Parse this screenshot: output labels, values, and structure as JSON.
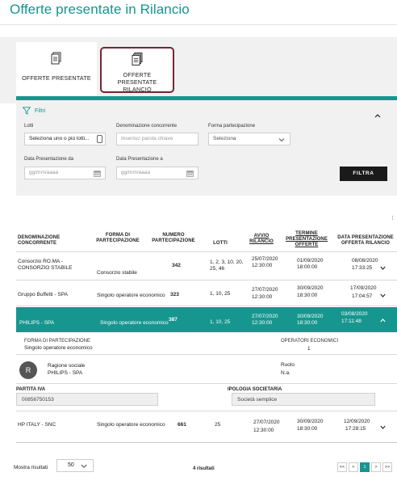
{
  "page": {
    "title": "Offerte presentate in Rilancio"
  },
  "tabs": [
    {
      "label": "OFFERTE PRESENTATE",
      "icon": "document-icon"
    },
    {
      "label": "OFFERTE PRESENTATE RILANCIO",
      "icon": "document-stack-icon",
      "selected": true
    }
  ],
  "filters": {
    "title": "Filtri",
    "lotti": {
      "label": "Lotti",
      "value": "Seleziona uno o più lotti..."
    },
    "denominazione": {
      "label": "Denominazione concorrente",
      "placeholder": "Inserisci parola chiave"
    },
    "forma": {
      "label": "Forma partecipazione",
      "value": "Seleziona"
    },
    "data_da": {
      "label": "Data Presentazione da",
      "placeholder": "gg/mm/aaaa"
    },
    "data_a": {
      "label": "Data Presentazione a",
      "placeholder": "gg/mm/aaaa"
    },
    "submit_label": "FILTRA"
  },
  "table": {
    "columns": [
      "DENOMINAZIONE CONCORRENTE",
      "FORMA DI PARTECIPAZIONE",
      "NUMERO PARTECIPAZIONE",
      "LOTTI",
      "AVVIO RILANCIO",
      "TERMINE PRESENTAZIONE OFFERTE",
      "DATA PRESENTAZIONE OFFERTA RILANCIO"
    ],
    "rows": [
      {
        "name": "Consorzio RO.MA - CONSORZIO STABILE",
        "forma": "Consorzio stabile",
        "numero": "342",
        "lotti": "1, 2, 3, 10, 20, 25, 46",
        "avvio_date": "25/07/2020",
        "avvio_time": "12:30:00",
        "termine_date": "01/09/2020",
        "termine_time": "18:00:00",
        "data_date": "08/08/2020",
        "data_time": "17:33:25"
      },
      {
        "name": "Gruppo Buffetti - SPA",
        "forma": "Singolo operatore economico",
        "numero": "323",
        "lotti": "1, 10, 25",
        "avvio_date": "27/07/2020",
        "avvio_time": "12:30:00",
        "termine_date": "30/09/2020",
        "termine_time": "18:30:00",
        "data_date": "17/09/2020",
        "data_time": "17:04:57"
      },
      {
        "name": "PHILIPS - SPA",
        "forma": "Singolo operatore economico",
        "numero": "387",
        "lotti": "1, 10, 25",
        "avvio_date": "27/07/2020",
        "avvio_time": "12:30:00",
        "termine_date": "30/09/2020",
        "termine_time": "18:30:00",
        "data_date": "03/08/2020",
        "data_time": "17:11:48"
      },
      {
        "name": "HP ITALY - SNC",
        "forma": "Singolo operatore economico",
        "numero": "661",
        "lotti": "25",
        "avvio_date": "27/07/2020",
        "avvio_time": "12:30:00",
        "termine_date": "30/09/2020",
        "termine_time": "18:30:00",
        "data_date": "12/09/2020",
        "data_time": "17:28:15"
      }
    ]
  },
  "details": {
    "forma_label": "FORMA DI PARTECIPAZIONE",
    "forma_value": "Singolo operatore economico",
    "operatori_label": "OPERATORI ECONOMICI",
    "operatori_value": "1",
    "avatar_letter": "R",
    "ragione_label": "Ragione sociale",
    "ragione_value": "PHILIPS - SPA",
    "ruolo_label": "Ruolo",
    "ruolo_value": "N.a.",
    "piva_label": "PARTITA IVA",
    "piva_value": "00856750153",
    "tipologia_label": "IPOLOGIA SOCIETARIA",
    "tipologia_value": "Società semplice"
  },
  "footer": {
    "mostra_label": "Mostra risultati",
    "per_page": "50",
    "count": "4 risultati",
    "pager": [
      "<<",
      "<",
      "1",
      ">",
      ">>"
    ],
    "current_page": "1"
  },
  "colors": {
    "accent": "#17968f",
    "title": "#11968f",
    "tab_outline": "#7a2337"
  }
}
